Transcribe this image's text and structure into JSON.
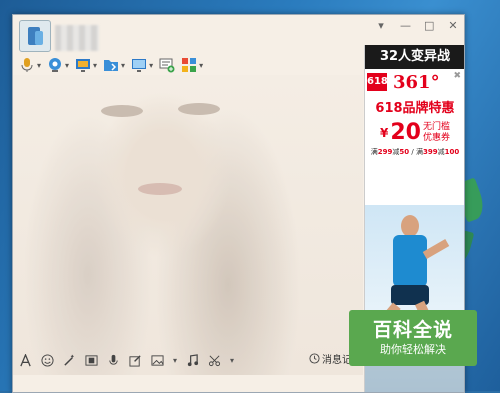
{
  "window": {
    "controls": {
      "menu": "▾",
      "minimize": "—",
      "maximize": "□",
      "close": "✕"
    }
  },
  "toolbar_top": {
    "items": [
      {
        "icon": "microphone-icon"
      },
      {
        "icon": "webcam-icon"
      },
      {
        "icon": "screen-share-icon"
      },
      {
        "icon": "folder-icon"
      },
      {
        "icon": "remote-desktop-icon"
      },
      {
        "icon": "message-add-icon"
      },
      {
        "icon": "apps-grid-icon"
      }
    ]
  },
  "ad": {
    "banner_top": "32人变异战",
    "badge_618": "618",
    "brand": "361°",
    "close": "✖",
    "headline": "618品牌特惠",
    "yen": "¥",
    "amount": "20",
    "coupon_line1": "无门槛",
    "coupon_line2": "优惠券",
    "deal_full": "满",
    "deal_a_amt": "299",
    "deal_a_off": "减",
    "deal_a_val": "50",
    "deal_sep": " / ",
    "deal_b_amt": "399",
    "deal_b_val": "100"
  },
  "toolbar_bottom": {
    "items": [
      {
        "icon": "font-icon"
      },
      {
        "icon": "emoji-icon"
      },
      {
        "icon": "magic-wand-icon"
      },
      {
        "icon": "video-clip-icon"
      },
      {
        "icon": "voice-message-icon"
      },
      {
        "icon": "edit-icon"
      },
      {
        "icon": "image-icon"
      },
      {
        "icon": "music-icon"
      },
      {
        "icon": "scissors-icon"
      }
    ],
    "history_label": "消息记录"
  },
  "watermark": {
    "title": "百科全说",
    "subtitle": "助你轻松解决"
  }
}
